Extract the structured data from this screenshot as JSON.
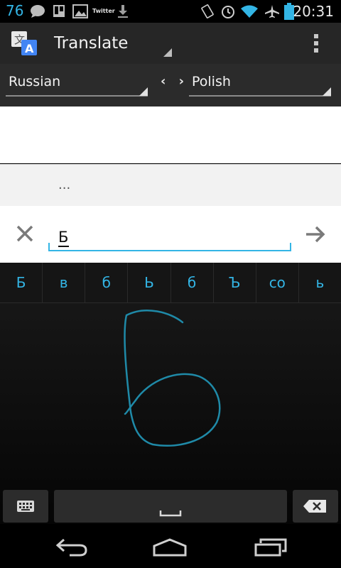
{
  "status_bar": {
    "notification_count": "76",
    "twitter_label": "Twitter",
    "time": "20:31",
    "icons": [
      "chat-icon",
      "trello-icon",
      "image-icon",
      "twitter-icon",
      "download-icon",
      "rotate-icon",
      "alarm-icon",
      "wifi-icon",
      "airplane-icon",
      "battery-icon"
    ]
  },
  "action_bar": {
    "title": "Translate",
    "icons": [
      "translate-app-icon",
      "overflow-menu-icon"
    ]
  },
  "languages": {
    "source": "Russian",
    "target": "Polish",
    "swap_label": "‹ ›"
  },
  "suggestion": {
    "text": "..."
  },
  "input": {
    "value": "Б",
    "icons": [
      "clear-icon",
      "go-arrow-icon"
    ]
  },
  "handwriting": {
    "candidates": [
      "Б",
      "в",
      "б",
      "Ь",
      "б",
      "Ъ",
      "со",
      "ь"
    ],
    "icons": [
      "keyboard-icon",
      "space-icon",
      "backspace-icon"
    ]
  },
  "nav": {
    "icons": [
      "back-icon",
      "home-icon",
      "recent-apps-icon"
    ]
  },
  "colors": {
    "accent": "#33b5e5",
    "stroke": "#1f8aa8",
    "action_bar": "#262626"
  }
}
